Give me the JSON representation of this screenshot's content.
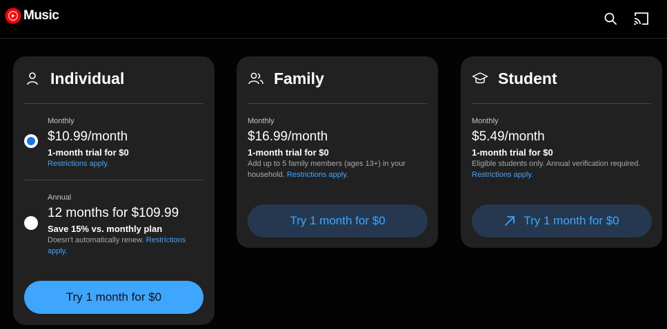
{
  "header": {
    "app_name": "Music",
    "icons": [
      "youtube-music-logo",
      "search-icon",
      "cast-icon"
    ]
  },
  "plans": [
    {
      "title": "Individual",
      "icon": "person-icon",
      "options": [
        {
          "period": "Monthly",
          "price": "$10.99/month",
          "trial": "1-month trial for $0",
          "note": "",
          "link": "Restrictions apply.",
          "selected": true
        },
        {
          "period": "Annual",
          "price": "12 months for $109.99",
          "trial": "Save 15% vs. monthly plan",
          "note": "Doesn't automatically renew.",
          "link": "Restrictions apply.",
          "selected": false
        }
      ],
      "button": "Try 1 month for $0"
    },
    {
      "title": "Family",
      "icon": "group-icon",
      "options": [
        {
          "period": "Monthly",
          "price": "$16.99/month",
          "trial": "1-month trial for $0",
          "note": "Add up to 5 family members (ages 13+) in your household.",
          "link": "Restrictions apply."
        }
      ],
      "button": "Try 1 month for $0"
    },
    {
      "title": "Student",
      "icon": "graduation-cap-icon",
      "options": [
        {
          "period": "Monthly",
          "price": "$5.49/month",
          "trial": "1-month trial for $0",
          "note": "Eligible students only. Annual verification required.",
          "link": "Restrictions apply."
        }
      ],
      "button": "Try 1 month for $0",
      "button_icon": "external-arrow-icon"
    }
  ],
  "colors": {
    "accent": "#3ea6ff",
    "radio_selected": "#1a73e8",
    "card_bg": "#212121",
    "secondary_button_bg": "#263850",
    "logo_red": "#ff0000"
  }
}
